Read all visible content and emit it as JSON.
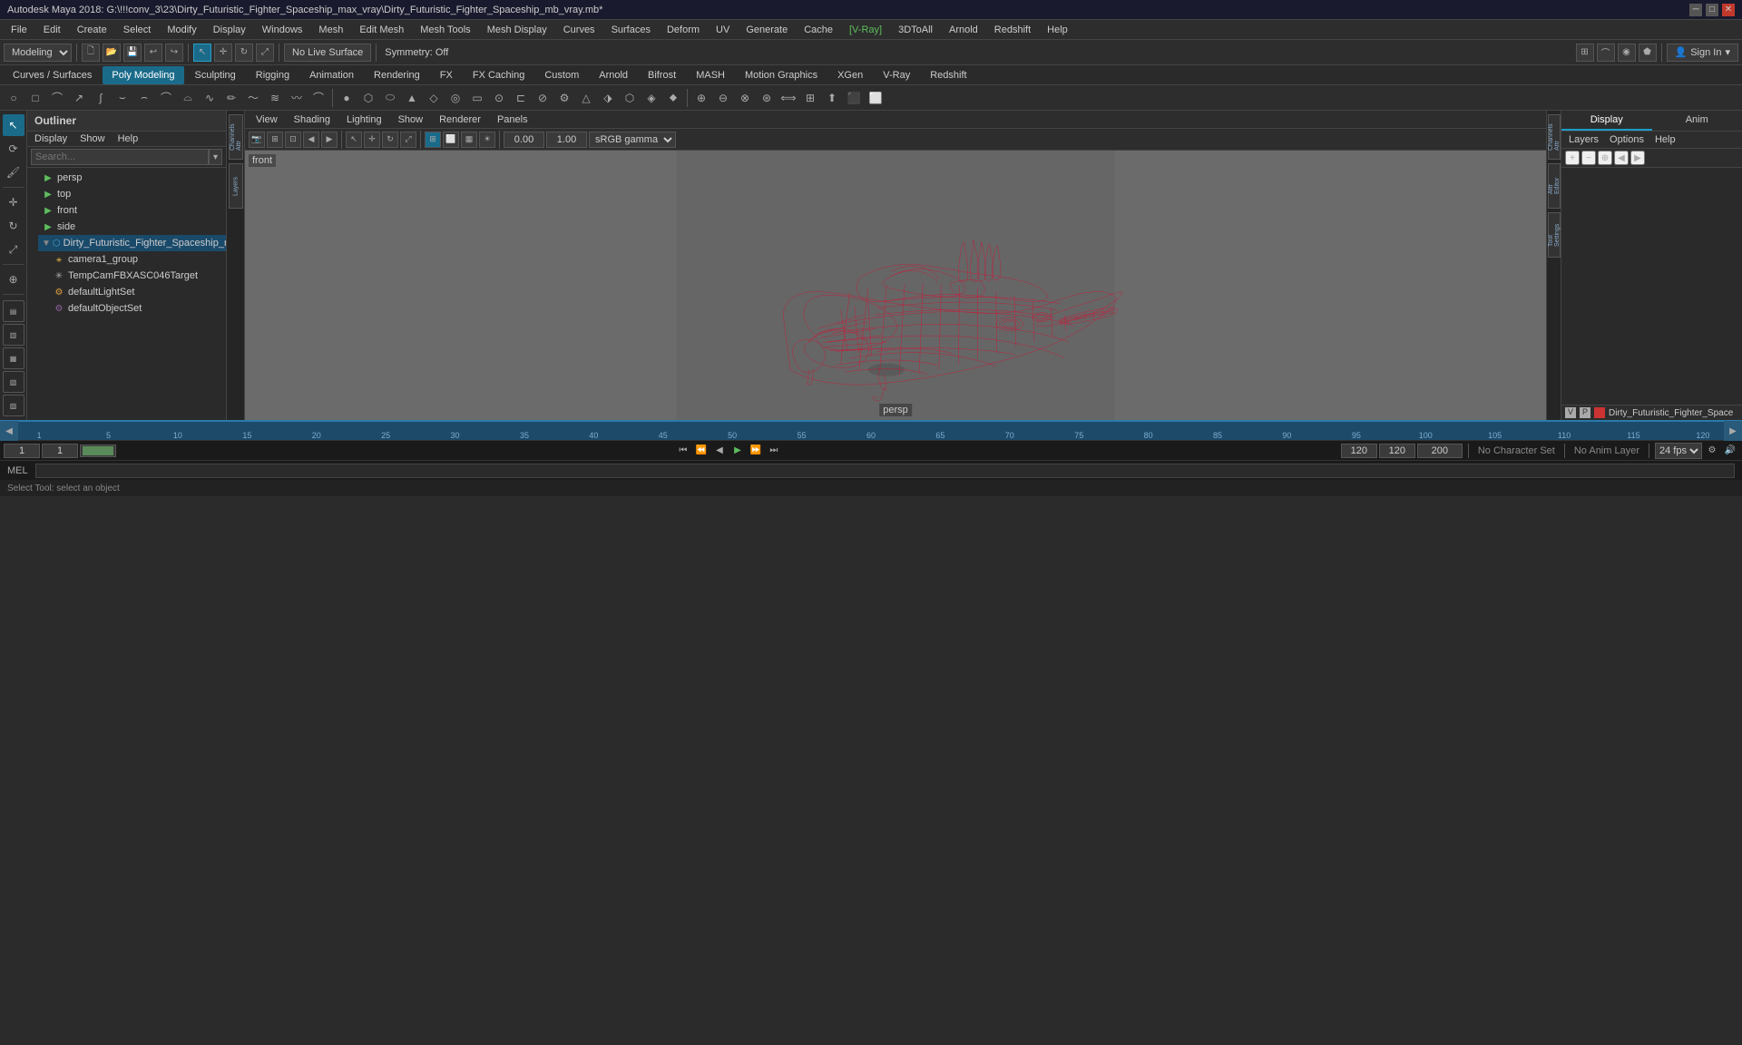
{
  "titlebar": {
    "title": "Autodesk Maya 2018: G:\\!!!conv_3\\23\\Dirty_Futuristic_Fighter_Spaceship_max_vray\\Dirty_Futuristic_Fighter_Spaceship_mb_vray.mb*",
    "controls": [
      "minimize",
      "maximize",
      "close"
    ]
  },
  "menubar": {
    "items": [
      "File",
      "Edit",
      "Create",
      "Select",
      "Modify",
      "Display",
      "Windows",
      "Mesh",
      "Edit Mesh",
      "Mesh Tools",
      "Mesh Display",
      "Curves",
      "Surfaces",
      "Deform",
      "UV",
      "Generate",
      "Cache",
      "V-Ray",
      "3DToAll",
      "Arnold",
      "Redshift",
      "Help"
    ]
  },
  "toolbar": {
    "workspace_label": "Modeling",
    "no_live_surface": "No Live Surface",
    "symmetry": "Symmetry: Off",
    "sign_in": "Sign In"
  },
  "module_tabs": {
    "items": [
      "Curves / Surfaces",
      "Poly Modeling",
      "Sculpting",
      "Rigging",
      "Animation",
      "Rendering",
      "FX",
      "FX Caching",
      "Custom",
      "Arnold",
      "Bifrost",
      "MASH",
      "Motion Graphics",
      "XGen",
      "V-Ray",
      "Redshift"
    ]
  },
  "outliner": {
    "title": "Outliner",
    "menu": [
      "Display",
      "Show",
      "Help"
    ],
    "search_placeholder": "Search...",
    "items": [
      {
        "name": "persp",
        "type": "camera",
        "indent": 1
      },
      {
        "name": "top",
        "type": "camera",
        "indent": 1
      },
      {
        "name": "front",
        "type": "camera",
        "indent": 1
      },
      {
        "name": "side",
        "type": "camera",
        "indent": 1
      },
      {
        "name": "Dirty_Futuristic_Fighter_Spaceship_n",
        "type": "mesh",
        "indent": 1
      },
      {
        "name": "camera1_group",
        "type": "group",
        "indent": 2
      },
      {
        "name": "TempCamFBXASC046Target",
        "type": "target",
        "indent": 2
      },
      {
        "name": "defaultLightSet",
        "type": "light",
        "indent": 2
      },
      {
        "name": "defaultObjectSet",
        "type": "set",
        "indent": 2
      }
    ]
  },
  "viewport": {
    "label_tl": "front",
    "label_bc": "persp",
    "values": {
      "val1": "0.00",
      "val2": "1.00",
      "color_space": "sRGB gamma"
    }
  },
  "right_panel": {
    "tabs": [
      "Display",
      "Anim"
    ],
    "header": [
      "Layers",
      "Options",
      "Help"
    ],
    "layer": {
      "name": "Dirty_Futuristic_Fighter_Space",
      "v": "V",
      "p": "P"
    }
  },
  "timeline": {
    "marks": [
      "1",
      "",
      "5",
      "",
      "10",
      "",
      "15",
      "",
      "20",
      "",
      "25",
      "",
      "30",
      "",
      "35",
      "",
      "40",
      "",
      "45",
      "",
      "50",
      "",
      "55",
      "",
      "60",
      "",
      "65",
      "",
      "70",
      "",
      "75",
      "",
      "80",
      "",
      "85",
      "",
      "90",
      "",
      "95",
      "",
      "100",
      "",
      "105",
      "",
      "110",
      "",
      "115",
      "",
      "120"
    ]
  },
  "status_bar": {
    "current_frame": "1",
    "start_frame": "1",
    "playback_start": "1",
    "end_frame": "120",
    "playback_end": "120",
    "range_end": "200",
    "no_character_set": "No Character Set",
    "no_anim_layer": "No Anim Layer",
    "fps": "24 fps"
  },
  "script_bar": {
    "label": "MEL",
    "placeholder": ""
  },
  "help_bar": {
    "text": "Select Tool: select an object"
  }
}
